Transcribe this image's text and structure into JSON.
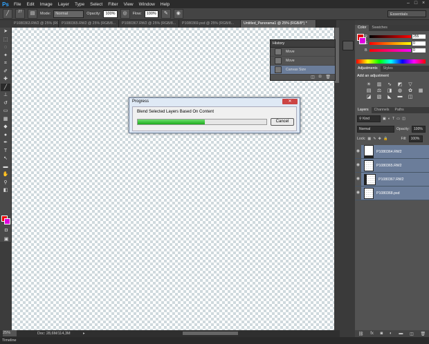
{
  "app": {
    "logo": "Ps"
  },
  "menu": [
    "File",
    "Edit",
    "Image",
    "Layer",
    "Type",
    "Select",
    "Filter",
    "View",
    "Window",
    "Help"
  ],
  "options_bar": {
    "mode_label": "Mode:",
    "mode_value": "Normal",
    "opacity_label": "Opacity:",
    "opacity_value": "100%",
    "flow_label": "Flow:",
    "flow_value": "100%",
    "brush_size": "27",
    "workspace": "Essentials"
  },
  "tabs": [
    {
      "label": "P1080363.RW2 @ 25% (RGB/8...",
      "active": false
    },
    {
      "label": "P1080365.RW2 @ 25% (RGB/8...",
      "active": false
    },
    {
      "label": "P1080367.RW2 @ 25% (RGB/8...",
      "active": false
    },
    {
      "label": "P1080369.psd @ 25% (RGB/8...",
      "active": false
    },
    {
      "label": "Untitled_Panorama1 @ 25% (RGB/8*) *",
      "active": true
    }
  ],
  "history": {
    "title": "History",
    "items": [
      {
        "label": "Move",
        "selected": false
      },
      {
        "label": "Move",
        "selected": false
      },
      {
        "label": "Canvas Size",
        "selected": true
      }
    ]
  },
  "progress_dialog": {
    "title": "Progress",
    "message": "Blend Selected Layers Based On Content",
    "progress": 0.52,
    "cancel_label": "Cancel"
  },
  "color_panel": {
    "tabs": [
      "Color",
      "Swatches"
    ],
    "channels": [
      {
        "label": "R",
        "value": "255"
      },
      {
        "label": "G",
        "value": "0"
      },
      {
        "label": "B",
        "value": "0"
      }
    ],
    "foreground": "#e00000",
    "background": "#e000e0"
  },
  "adjustments_panel": {
    "tabs": [
      "Adjustments",
      "Styles"
    ],
    "heading": "Add an adjustment"
  },
  "layers_panel": {
    "tabs": [
      "Layers",
      "Channels",
      "Paths"
    ],
    "kind_label": "Kind",
    "blend_mode": "Normal",
    "opacity_label": "Opacity:",
    "opacity_value": "100%",
    "lock_label": "Lock:",
    "fill_label": "Fill:",
    "fill_value": "100%",
    "layers": [
      "P1080364.RW2",
      "P1080365.RW2",
      "P1080367.RW2",
      "P1080368.psd"
    ]
  },
  "status": {
    "zoom": "25%",
    "doc": "Doc: 28,6M/114,3M",
    "bottom_label": "Timeline"
  }
}
